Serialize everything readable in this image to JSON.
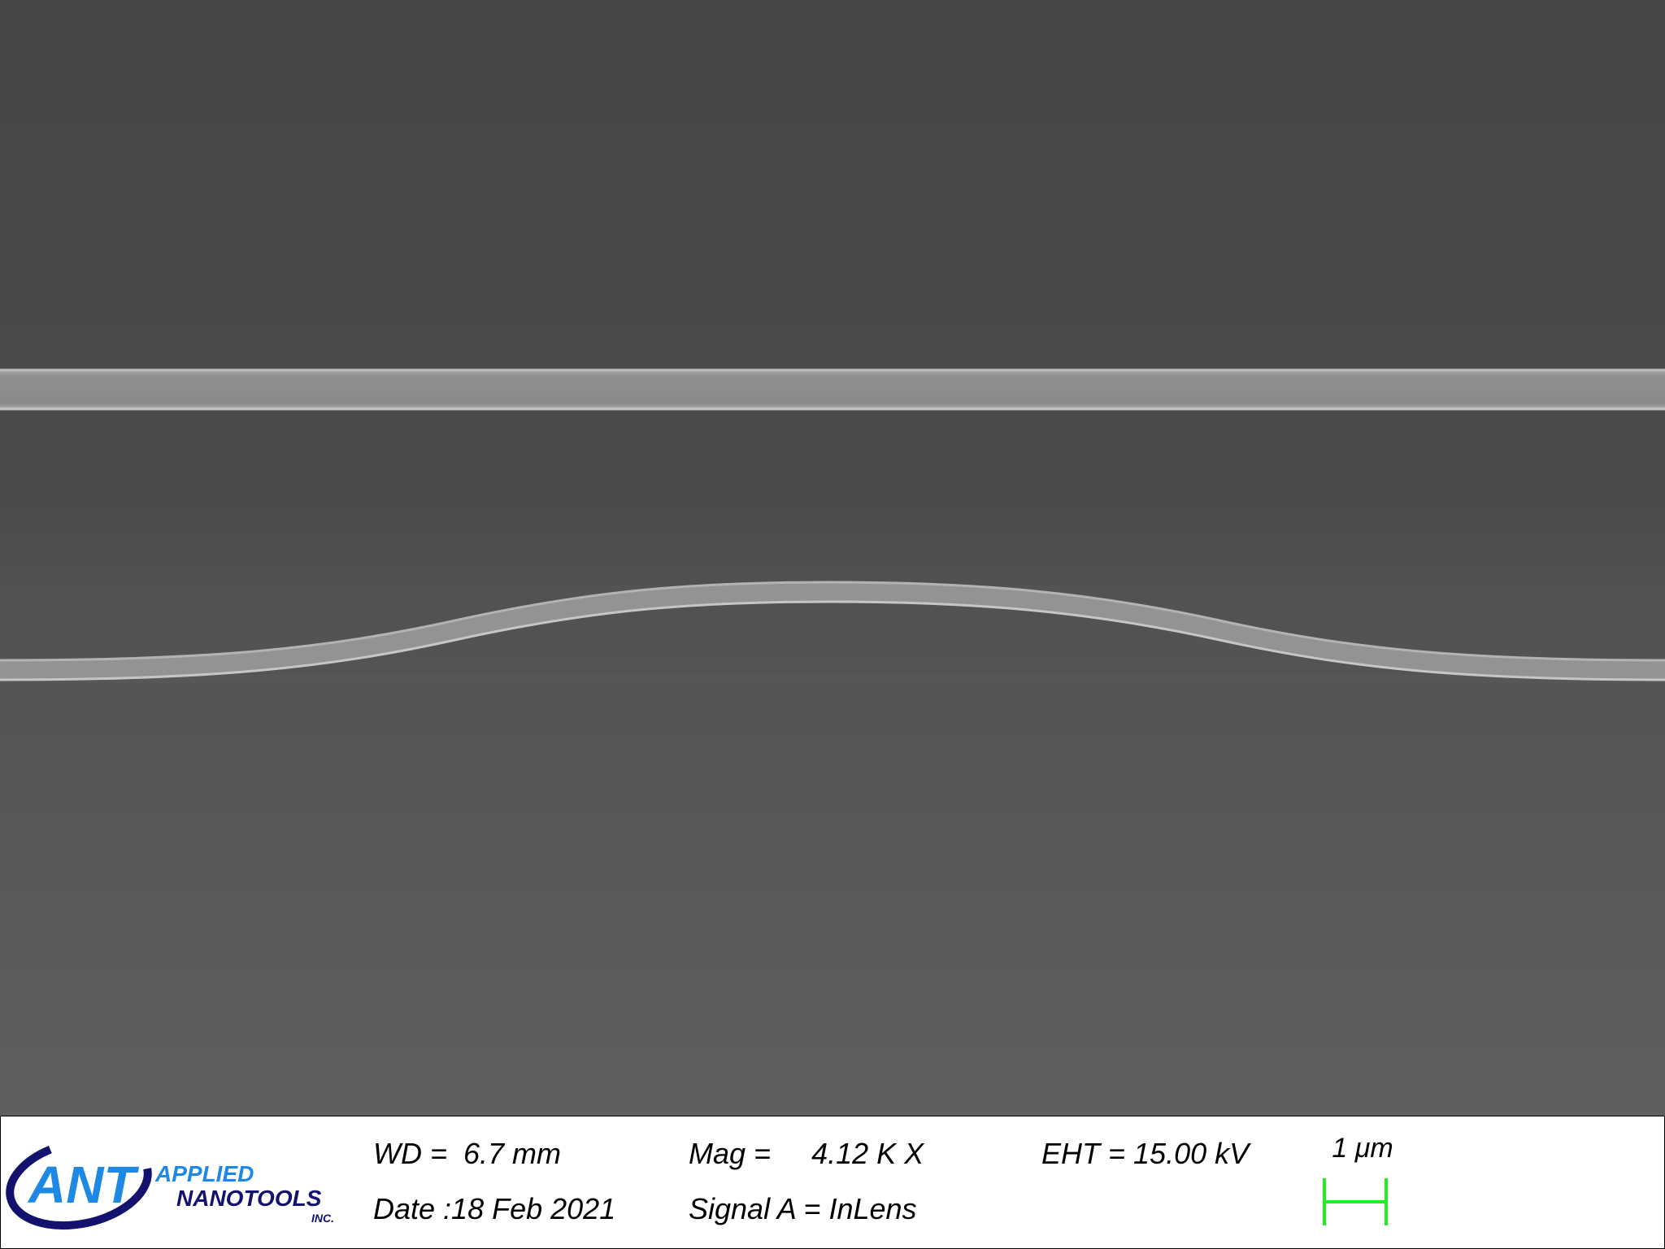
{
  "logo": {
    "mark": "ANT",
    "line1": "APPLIED",
    "line2": "NANOTOOLS",
    "suffix": "INC.",
    "colors": {
      "blue_light": "#1e88e5",
      "blue_dark": "#13126e"
    }
  },
  "metadata": {
    "wd": "WD =  6.7 mm",
    "date": "Date :18 Feb 2021",
    "mag": "Mag =     4.12 K X",
    "signal": "Signal A = InLens",
    "eht": "EHT = 15.00 kV"
  },
  "scale_bar": {
    "label": "1 μm",
    "color": "#22ee22"
  },
  "image": {
    "background_top": "#434343",
    "background_bottom": "#5e5e5e",
    "waveguide_color": "#8f8f8f",
    "waveguide_edge": "#b4b4b4"
  }
}
